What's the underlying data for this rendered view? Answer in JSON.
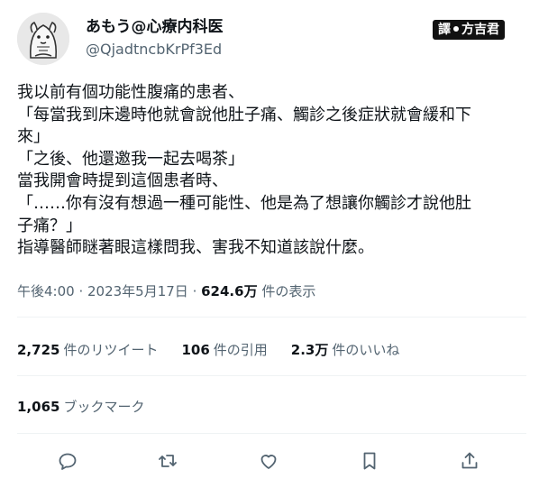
{
  "author": {
    "display_name": "あもう@心療内科医",
    "handle": "@QjadtncbKrPf3Ed"
  },
  "watermark": {
    "left": "譯",
    "right": "方吉君"
  },
  "tweet": {
    "lines": [
      "我以前有個功能性腹痛的患者、",
      "「每當我到床邊時他就會說他肚子痛、觸診之後症狀就會緩和下",
      "來」",
      "「之後、他還邀我一起去喝茶」",
      "當我開會時提到這個患者時、",
      "「……你有沒有想過一種可能性、他是為了想讓你觸診才說他肚",
      "子痛？」",
      "指導醫師瞇著眼這樣問我、害我不知道該說什麼。"
    ]
  },
  "meta": {
    "time": "午後4:00",
    "dot1": " · ",
    "date": "2023年5月17日",
    "dot2": " · ",
    "views": "624.6万",
    "views_label": " 件の表示"
  },
  "stats": {
    "retweets_count": "2,725",
    "retweets_label": "件のリツイート",
    "quotes_count": "106",
    "quotes_label": "件の引用",
    "likes_count": "2.3万",
    "likes_label": "件のいいね"
  },
  "bookmarks": {
    "count": "1,065",
    "label": "ブックマーク"
  },
  "icons": {
    "reply": "reply-icon",
    "retweet": "retweet-icon",
    "like": "heart-icon",
    "bookmark": "bookmark-icon",
    "share": "share-icon"
  },
  "colors": {
    "text": "#0f1419",
    "secondary": "#536471",
    "divider": "#eff3f4"
  }
}
